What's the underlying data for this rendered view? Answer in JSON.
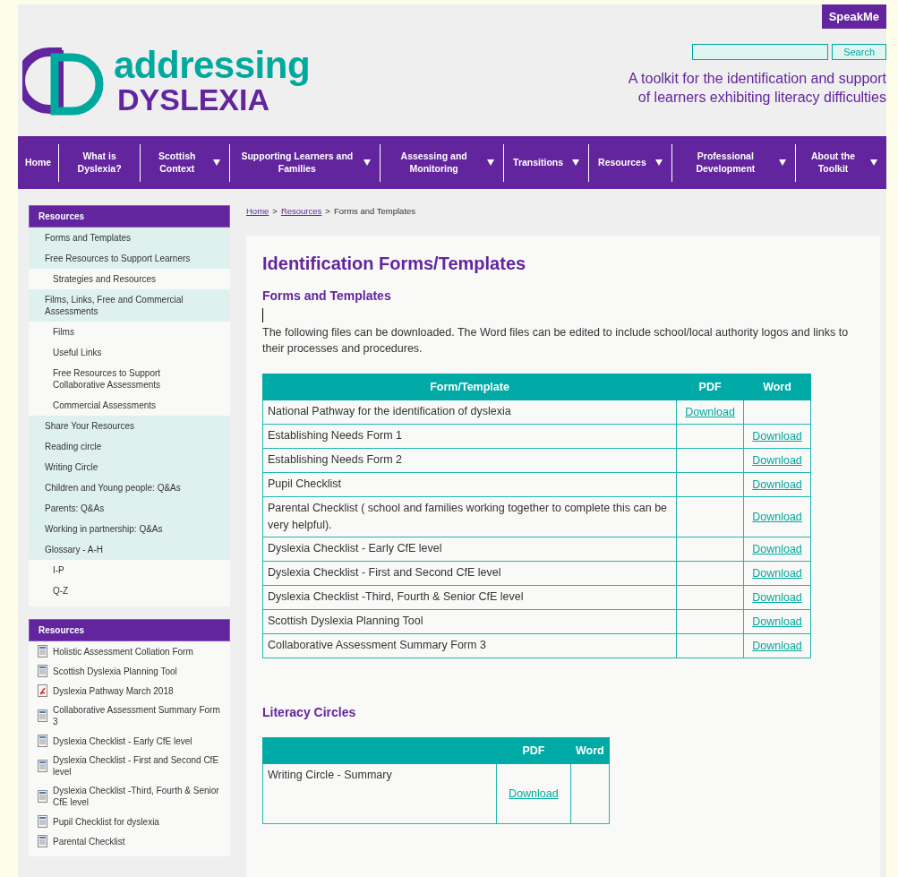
{
  "speak_button": "SpeakMe",
  "search": {
    "button": "Search"
  },
  "logo": {
    "line_1": "addressing",
    "line_2": "DYSLEXIA"
  },
  "tagline": [
    "A toolkit for the identification and support",
    "of learners exhibiting literacy difficulties"
  ],
  "nav": [
    {
      "label": "Home",
      "dropdown": false
    },
    {
      "label": "What is Dyslexia?",
      "dropdown": false
    },
    {
      "label": "Scottish Context",
      "dropdown": true
    },
    {
      "label": "Supporting Learners and Families",
      "dropdown": true
    },
    {
      "label": "Assessing and Monitoring",
      "dropdown": true
    },
    {
      "label": "Transitions",
      "dropdown": true
    },
    {
      "label": "Resources",
      "dropdown": true
    },
    {
      "label": "Professional Development",
      "dropdown": true
    },
    {
      "label": "About the Toolkit",
      "dropdown": true
    }
  ],
  "sidebar": {
    "title": "Resources",
    "items": [
      {
        "label": "Forms and Templates"
      },
      {
        "label": "Free Resources to Support Learners",
        "children": [
          {
            "label": "Strategies and Resources"
          }
        ]
      },
      {
        "label": "Films, Links, Free and Commercial Assessments",
        "children": [
          {
            "label": "Films"
          },
          {
            "label": "Useful Links"
          },
          {
            "label": "Free Resources to Support Collaborative Assessments"
          },
          {
            "label": "Commercial Assessments"
          }
        ]
      },
      {
        "label": "Share Your Resources"
      },
      {
        "label": "Reading circle"
      },
      {
        "label": "Writing Circle"
      },
      {
        "label": "Children and Young people: Q&As"
      },
      {
        "label": "Parents: Q&As"
      },
      {
        "label": "Working in partnership: Q&As"
      },
      {
        "label": "Glossary - A-H",
        "children": [
          {
            "label": "I-P"
          },
          {
            "label": "Q-Z"
          }
        ]
      }
    ]
  },
  "resources": {
    "title": "Resources",
    "items": [
      {
        "label": "Holistic Assessment Collation Form",
        "kind": "word"
      },
      {
        "label": "Scottish Dyslexia Planning Tool",
        "kind": "word"
      },
      {
        "label": "Dyslexia Pathway March 2018",
        "kind": "pdf"
      },
      {
        "label": "Collaborative Assessment Summary Form 3",
        "kind": "word"
      },
      {
        "label": "Dyslexia Checklist - Early CfE level",
        "kind": "word"
      },
      {
        "label": "Dyslexia Checklist - First and Second CfE level",
        "kind": "word"
      },
      {
        "label": "Dyslexia Checklist -Third, Fourth & Senior CfE level",
        "kind": "word"
      },
      {
        "label": "Pupil Checklist for dyslexia",
        "kind": "word"
      },
      {
        "label": "Parental Checklist",
        "kind": "word"
      }
    ]
  },
  "breadcrumb": {
    "links": [
      "Home",
      "Resources"
    ],
    "separators": [
      ">",
      ">"
    ],
    "current": "Forms and Templates"
  },
  "title": "Identification Forms/Templates",
  "sections": [
    {
      "heading": "Forms and Templates",
      "intro": "The following files can be downloaded. The Word files can be edited to include school/local authority logos and links to their processes and procedures.",
      "table": {
        "columns": [
          "Form/Template",
          "PDF",
          "Word"
        ],
        "rows": [
          {
            "name": "National Pathway for the identification of dyslexia",
            "pdf": "Download"
          },
          {
            "name": "Establishing Needs Form 1",
            "word": "Download"
          },
          {
            "name": "Establishing Needs Form 2",
            "word": "Download"
          },
          {
            "name": "Pupil Checklist",
            "word": "Download"
          },
          {
            "name": "Parental Checklist ( school and families working together to complete this can be very helpful).",
            "word": "Download"
          },
          {
            "name": "Dyslexia Checklist - Early CfE level",
            "word": "Download"
          },
          {
            "name": "Dyslexia Checklist - First and Second CfE level",
            "word": "Download"
          },
          {
            "name": "Dyslexia Checklist -Third, Fourth & Senior CfE level",
            "word": "Download"
          },
          {
            "name": "Scottish Dyslexia Planning Tool",
            "word": "Download"
          },
          {
            "name": "Collaborative Assessment Summary Form 3",
            "word": "Download"
          }
        ]
      }
    },
    {
      "heading": "Literacy Circles",
      "table": {
        "columns": [
          "PDF",
          "Word"
        ],
        "rows": [
          {
            "name": "Writing Circle - Summary",
            "pdf": "Download"
          }
        ]
      }
    }
  ]
}
